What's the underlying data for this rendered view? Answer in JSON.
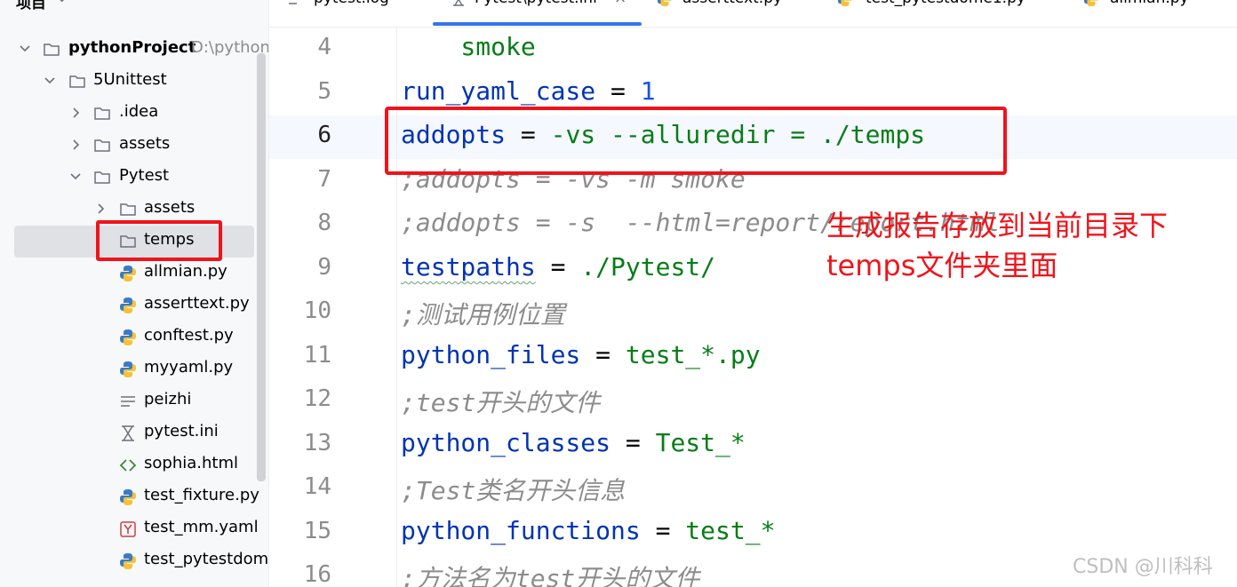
{
  "project_panel": {
    "title": "项目",
    "tree": [
      {
        "label": "pythonProject",
        "hint": "D:\\python",
        "type": "folder",
        "expanded": true
      },
      {
        "label": "5Unittest",
        "type": "folder",
        "expanded": true
      },
      {
        "label": ".idea",
        "type": "folder",
        "expanded": false
      },
      {
        "label": "assets",
        "type": "folder",
        "expanded": false
      },
      {
        "label": "Pytest",
        "type": "folder",
        "expanded": true
      },
      {
        "label": "assets",
        "type": "folder",
        "expanded": false
      },
      {
        "label": "temps",
        "type": "folder",
        "selected": true
      },
      {
        "label": "allmian.py",
        "type": "python"
      },
      {
        "label": "asserttext.py",
        "type": "python"
      },
      {
        "label": "conftest.py",
        "type": "python"
      },
      {
        "label": "myyaml.py",
        "type": "python"
      },
      {
        "label": "peizhi",
        "type": "text"
      },
      {
        "label": "pytest.ini",
        "type": "ini"
      },
      {
        "label": "sophia.html",
        "type": "html"
      },
      {
        "label": "test_fixture.py",
        "type": "python"
      },
      {
        "label": "test_mm.yaml",
        "type": "yaml"
      },
      {
        "label": "test_pytestdome",
        "type": "python"
      }
    ]
  },
  "tabs": [
    {
      "label": "pytest.log"
    },
    {
      "label": "Pytest\\pytest.ini",
      "active": true,
      "close": "×"
    },
    {
      "label": "asserttext.py"
    },
    {
      "label": "test_pytestdome1.py"
    },
    {
      "label": "allmian.py"
    }
  ],
  "editor": {
    "lines": [
      {
        "num": "4",
        "text": "    smoke"
      },
      {
        "num": "5",
        "key": "run_yaml_case",
        "eq": " = ",
        "value": "1"
      },
      {
        "num": "6",
        "key": "addopts",
        "eq": " = ",
        "value": "-vs --alluredir = ./temps"
      },
      {
        "num": "7",
        "comment": ";addopts = -vs -m smoke"
      },
      {
        "num": "8",
        "comment": ";addopts = -s  --html=report/report.html"
      },
      {
        "num": "9",
        "key": "testpaths",
        "eq": " = ",
        "value": "./Pytest/"
      },
      {
        "num": "10",
        "comment": ";测试用例位置"
      },
      {
        "num": "11",
        "key": "python_files",
        "eq": " = ",
        "value": "test_*.py"
      },
      {
        "num": "12",
        "comment": ";test开头的文件"
      },
      {
        "num": "13",
        "key": "python_classes",
        "eq": " = ",
        "value": "Test_*"
      },
      {
        "num": "14",
        "comment": ";Test类名开头信息"
      },
      {
        "num": "15",
        "key": "python_functions",
        "eq": " = ",
        "value": "test_*"
      },
      {
        "num": "16",
        "comment": ";方法名为test开头的文件"
      }
    ]
  },
  "annotation": {
    "line1": "生成报告存放到当前目录下",
    "line2": "temps文件夹里面",
    "color": "#f0131a"
  },
  "watermark": "CSDN @川科科"
}
